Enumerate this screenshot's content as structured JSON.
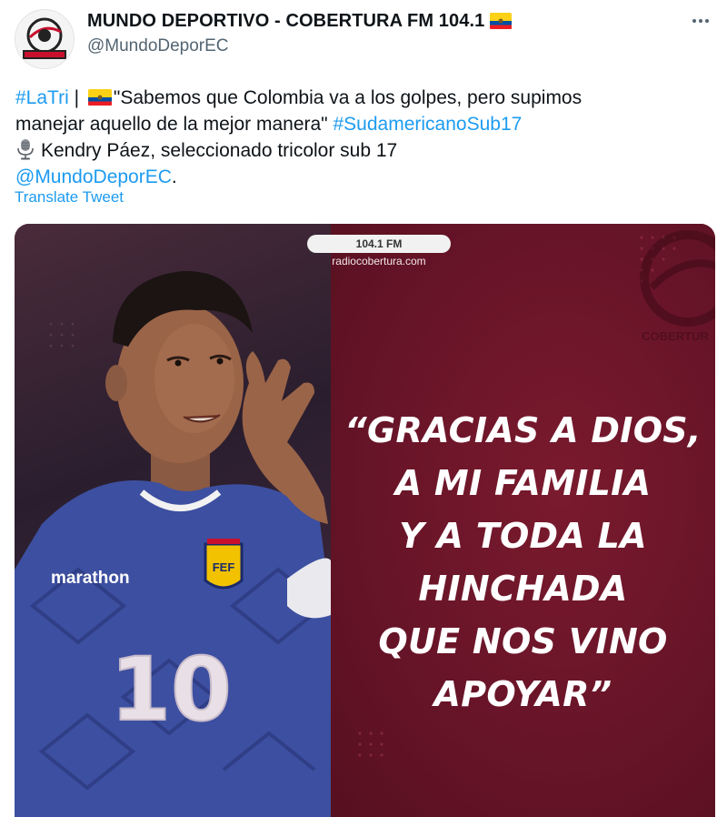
{
  "header": {
    "display_name": "MUNDO DEPORTIVO - COBERTURA FM 104.1",
    "handle": "@MundoDeporEC",
    "avatar_text": "COBERTURA FM 104.1"
  },
  "tweet": {
    "line1_hashtag": "#LaTri",
    "line1_sep": " | ",
    "line1_quote": "\"Sabemos que Colombia va a los golpes, pero supimos",
    "line2_text": "manejar aquello de la mejor manera\" ",
    "line2_hashtag": "#SudamericanoSub17",
    "line3_text": "Kendry Páez, seleccionado tricolor sub 17",
    "line4_mention": "@MundoDeporEC",
    "line4_end": ".",
    "translate_label": "Translate Tweet"
  },
  "media": {
    "station_frequency": "104.1 FM",
    "station_url": "radiocobertura.com",
    "corner_logo_text": "COBERTUR",
    "quote_lines": [
      "“GRACIAS A DIOS,",
      "A MI FAMILIA",
      "Y A TODA LA",
      "HINCHADA",
      "QUE NOS VINO",
      "APOYAR”"
    ],
    "jersey_brand": "marathon",
    "jersey_number": "10",
    "crest_text": "FEF"
  },
  "colors": {
    "link": "#1d9bf0",
    "secondary_text": "#536471",
    "maroon_background": "#6a1427",
    "jersey_blue": "#3d4fa0"
  },
  "icons": {
    "more": "more-options-icon",
    "flag": "ecuador-flag-icon",
    "mic": "studio-microphone-icon"
  }
}
